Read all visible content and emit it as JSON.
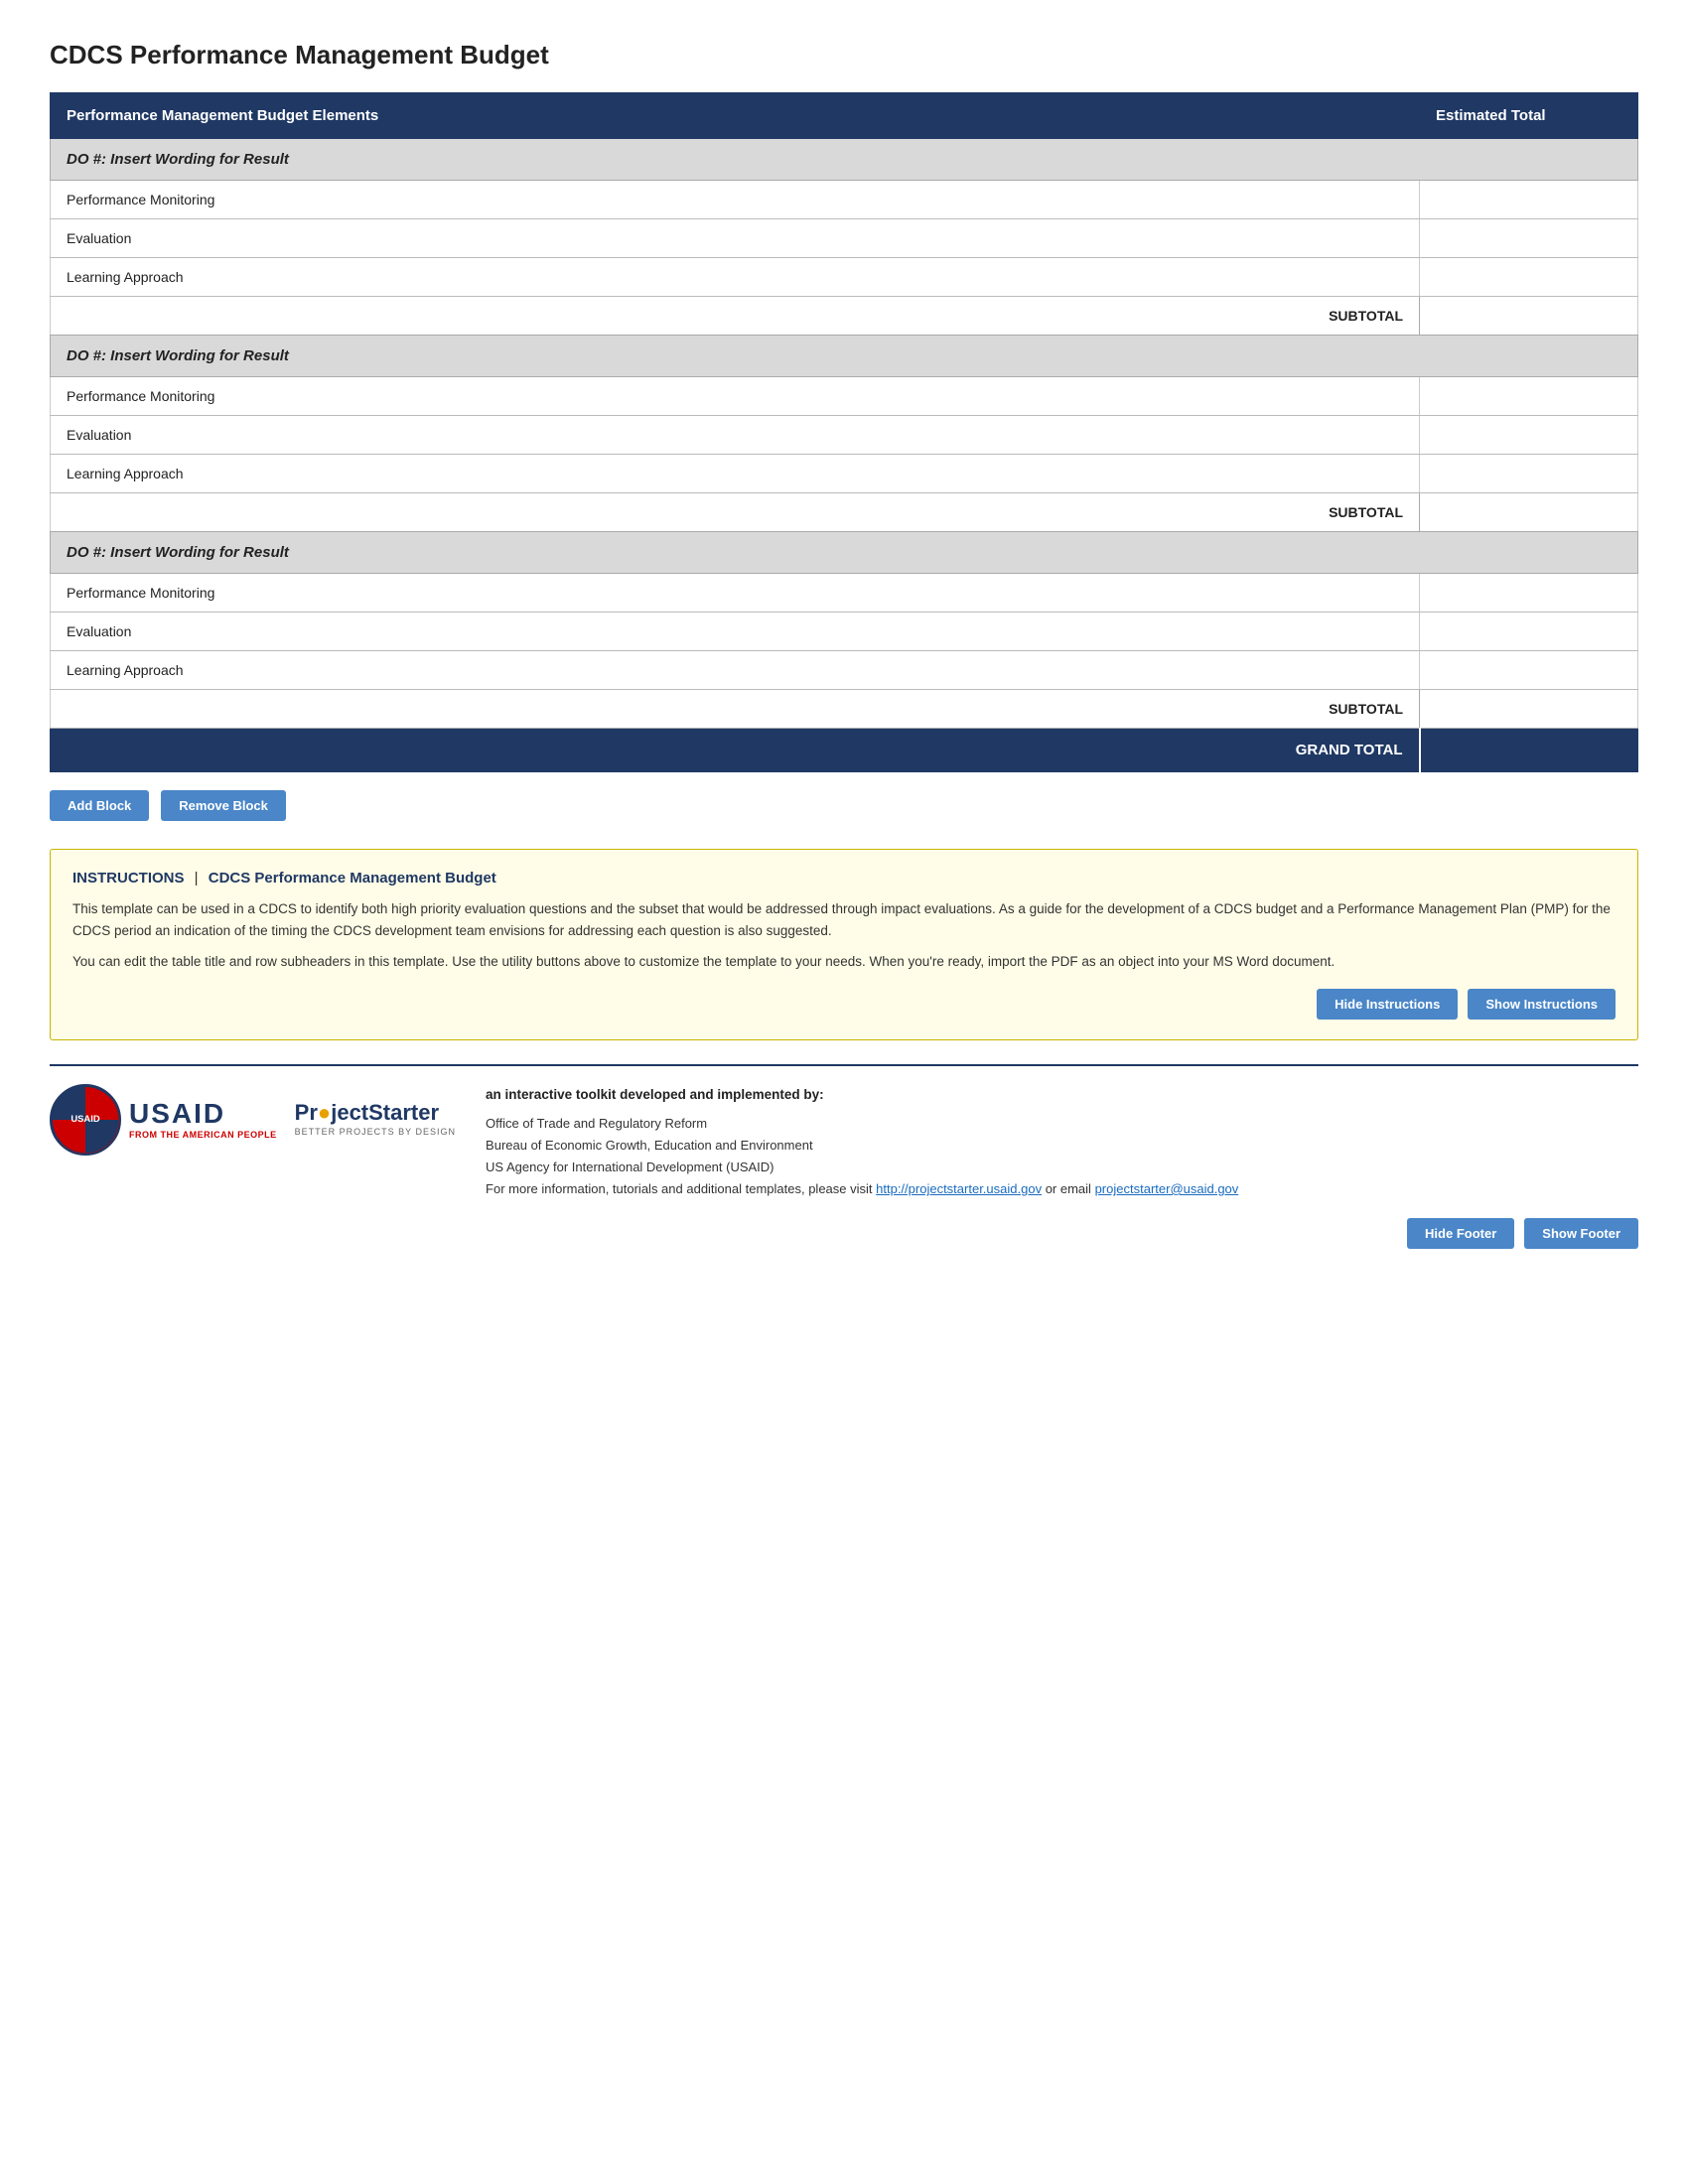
{
  "page": {
    "title": "CDCS Performance Management Budget"
  },
  "table": {
    "col1_header": "Performance Management Budget Elements",
    "col2_header": "Estimated Total",
    "blocks": [
      {
        "header": "DO #: Insert Wording for Result",
        "rows": [
          {
            "label": "Performance Monitoring",
            "value": ""
          },
          {
            "label": "Evaluation",
            "value": ""
          },
          {
            "label": "Learning Approach",
            "value": ""
          }
        ],
        "subtotal_label": "SUBTOTAL",
        "subtotal_value": ""
      },
      {
        "header": "DO #: Insert Wording for Result",
        "rows": [
          {
            "label": "Performance Monitoring",
            "value": ""
          },
          {
            "label": "Evaluation",
            "value": ""
          },
          {
            "label": "Learning Approach",
            "value": ""
          }
        ],
        "subtotal_label": "SUBTOTAL",
        "subtotal_value": ""
      },
      {
        "header": "DO #: Insert Wording for Result",
        "rows": [
          {
            "label": "Performance Monitoring",
            "value": ""
          },
          {
            "label": "Evaluation",
            "value": ""
          },
          {
            "label": "Learning Approach",
            "value": ""
          }
        ],
        "subtotal_label": "SUBTOTAL",
        "subtotal_value": ""
      }
    ],
    "grand_total_label": "GRAND TOTAL",
    "grand_total_value": ""
  },
  "buttons": {
    "add_block": "Add Block",
    "remove_block": "Remove Block"
  },
  "instructions": {
    "label": "INSTRUCTIONS",
    "pipe": "|",
    "title": "CDCS Performance Management Budget",
    "para1": "This template can be used in a CDCS to identify both high priority evaluation questions and the subset that would be addressed through impact evaluations. As a guide for the development of a CDCS budget and a Performance Management Plan (PMP) for the CDCS period an indication of the timing the CDCS development team envisions for addressing each question is also suggested.",
    "para2": "You can edit the table title and row subheaders in this template. Use the utility buttons above to customize the template to your needs. When you're ready, import the PDF as an object into your MS Word document.",
    "hide_btn": "Hide Instructions",
    "show_btn": "Show Instructions"
  },
  "footer": {
    "usaid_main": "USAID",
    "usaid_sub": "FROM THE AMERICAN PEOPLE",
    "ps_name_part1": "Pr",
    "ps_name_dot": "o",
    "ps_name_part2": "jectStarter",
    "ps_tagline": "BETTER PROJECTS BY DESIGN",
    "developed_by": "an interactive toolkit developed and implemented by:",
    "org1": "Office of Trade and Regulatory Reform",
    "org2": "Bureau of Economic Growth, Education and Environment",
    "org3": "US Agency for International Development (USAID)",
    "more_info": "For more information, tutorials and additional templates, please visit",
    "url": "http://projectstarter.usaid.gov",
    "or_email": "or email",
    "email": "projectstarter@usaid.gov",
    "hide_footer_btn": "Hide Footer",
    "show_footer_btn": "Show Footer"
  }
}
